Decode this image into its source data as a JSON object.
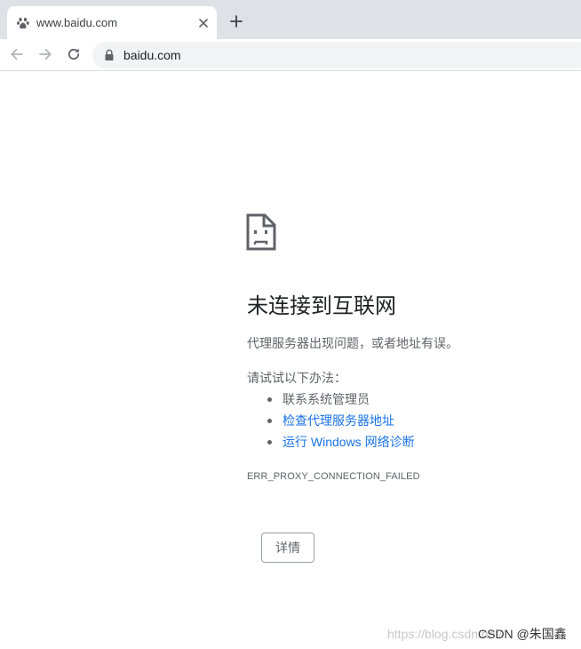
{
  "browser": {
    "tab": {
      "title": "www.baidu.com",
      "favicon": "baidu-paw-icon"
    },
    "new_tab_label": "+",
    "toolbar": {
      "back_icon": "arrow-left-icon",
      "forward_icon": "arrow-right-icon",
      "reload_icon": "reload-icon",
      "url": "baidu.com",
      "lock_icon": "lock-icon"
    }
  },
  "error_page": {
    "icon": "sad-document-icon",
    "title": "未连接到互联网",
    "description": "代理服务器出现问题，或者地址有误。",
    "suggestions_heading": "请试试以下办法：",
    "suggestions": [
      {
        "label": "联系系统管理员",
        "is_link": false
      },
      {
        "label": "检查代理服务器地址",
        "is_link": true
      },
      {
        "label": "运行 Windows 网络诊断",
        "is_link": true
      }
    ],
    "error_code": "ERR_PROXY_CONNECTION_FAILED",
    "details_button": "详情"
  },
  "watermark": {
    "url_part": "https://blog.csdn.net/",
    "author": "CSDN @朱国鑫"
  },
  "colors": {
    "tabstrip_bg": "#dee1e6",
    "omnibox_bg": "#f1f3f4",
    "link": "#1a73e8",
    "secondary_text": "#5f6368",
    "title_text": "#202124"
  }
}
